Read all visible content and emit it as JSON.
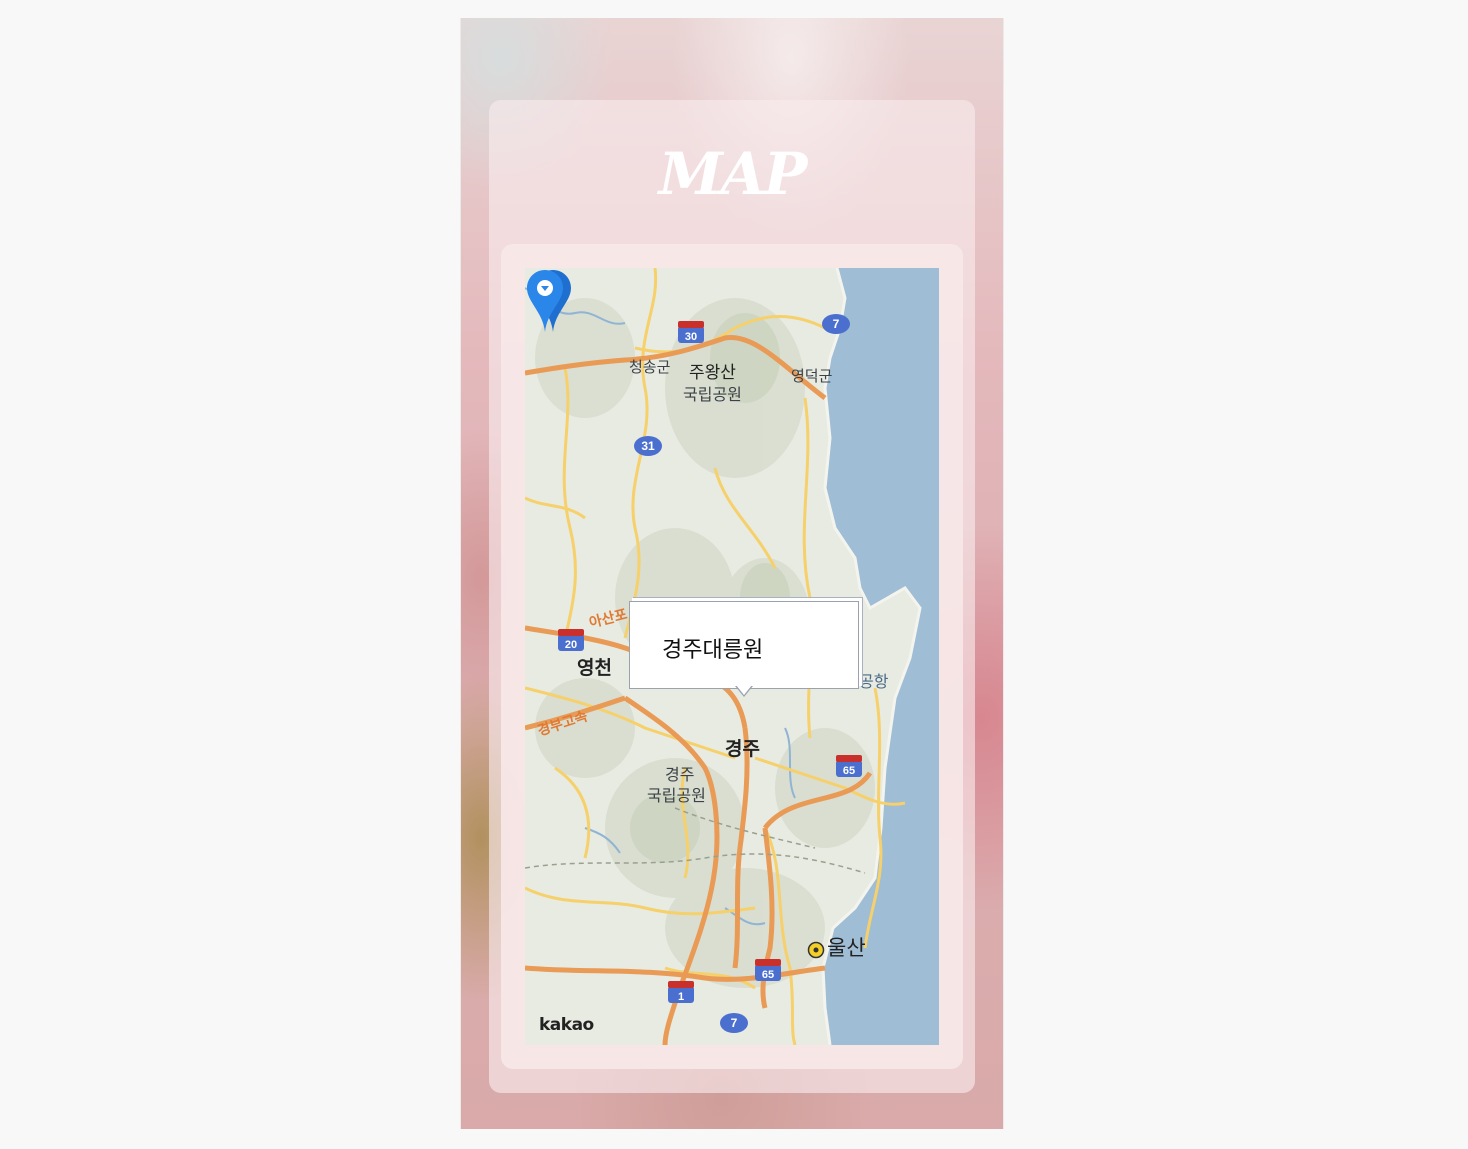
{
  "page": {
    "title": "MAP"
  },
  "map": {
    "provider_logo": "kakao",
    "marker_popup": "경주대릉원",
    "marker_icon": "map-pin-icon",
    "place_labels": {
      "cheongsong": "청송군",
      "juwangsan_line1": "주왕산",
      "juwangsan_line2": "국립공원",
      "yeongdeok": "영덕군",
      "yeongcheon": "영천",
      "airport": "공항",
      "gyeongju_city": "경주",
      "gyeongju_park_line1": "경주",
      "gyeongju_park_line2": "국립공원",
      "ulsan": "울산",
      "highway": "경부고속",
      "asan": "아산포"
    },
    "route_shields": [
      "30",
      "7",
      "31",
      "20",
      "65",
      "65",
      "1",
      "7"
    ],
    "colors": {
      "sea": "#9fbdd5",
      "land": "#e8ebe2",
      "highway": "#e99a55",
      "road": "#f6d06a",
      "marker": "#2a86e8"
    }
  }
}
